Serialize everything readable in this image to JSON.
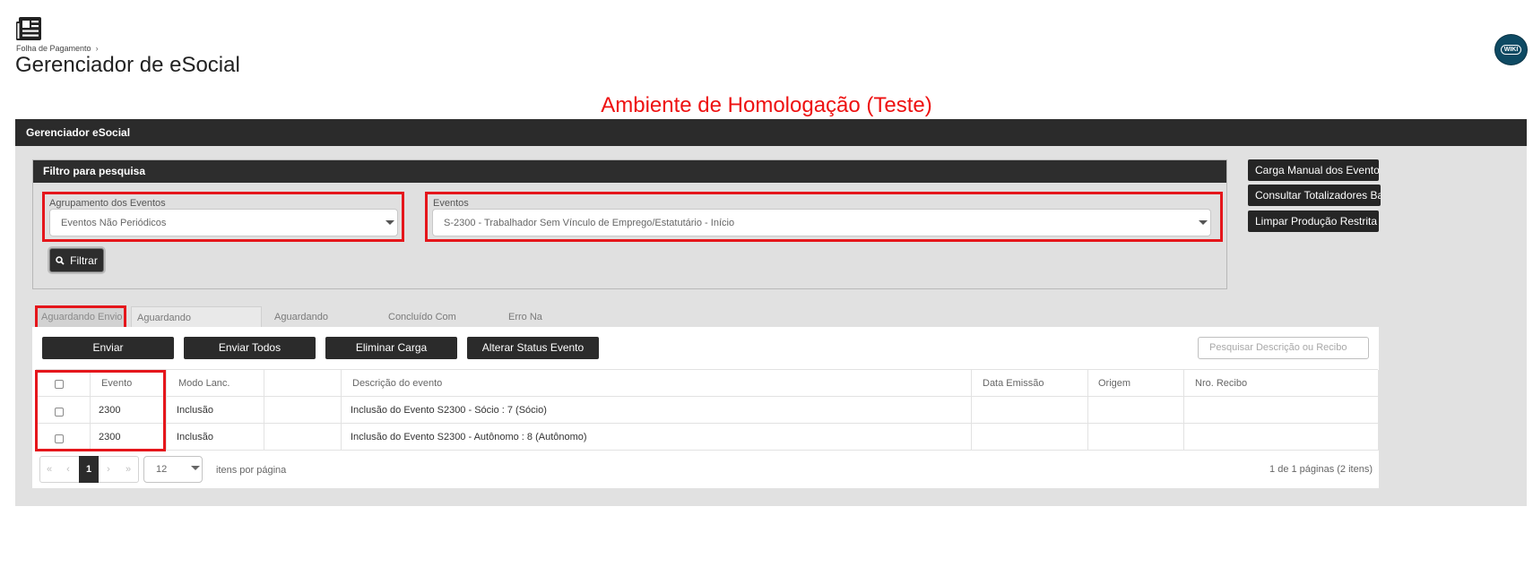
{
  "header": {
    "breadcrumb": "Folha de Pagamento",
    "title": "Gerenciador de eSocial",
    "wiki_label": "WIKI",
    "environment_banner": "Ambiente de Homologação (Teste)"
  },
  "main_panel": {
    "title": "Gerenciador eSocial"
  },
  "filter": {
    "title": "Filtro para pesquisa",
    "group_label": "Agrupamento dos Eventos",
    "group_value": "Eventos Não Periódicos",
    "events_label": "Eventos",
    "events_value": "S-2300 - Trabalhador Sem Vínculo de Emprego/Estatutário - Início",
    "filter_button": "Filtrar"
  },
  "side_actions": [
    "Carga Manual dos Eventos",
    "Consultar Totalizadores Base",
    "Limpar Produção Restrita"
  ],
  "tabs": [
    "Aguardando Envio",
    "Aguardando Processamento",
    "Aguardando Correções",
    "Concluído Com Sucesso",
    "Erro Na Consulta"
  ],
  "toolbar": {
    "send": "Enviar",
    "send_all": "Enviar Todos",
    "delete_load": "Eliminar Carga",
    "change_status": "Alterar Status Evento",
    "search_placeholder": "Pesquisar Descrição ou Recibo"
  },
  "table": {
    "columns": [
      "Evento",
      "Modo Lanc.",
      "",
      "Descrição do evento",
      "Data Emissão",
      "Origem",
      "Nro. Recibo"
    ],
    "rows": [
      {
        "evento": "2300",
        "modo": "Inclusão",
        "extra": "",
        "descricao": "Inclusão do Evento S2300 - Sócio : 7 (Sócio)",
        "data_emissao": "",
        "origem": "",
        "recibo": ""
      },
      {
        "evento": "2300",
        "modo": "Inclusão",
        "extra": "",
        "descricao": "Inclusão do Evento S2300 - Autônomo : 8 (Autônomo)",
        "data_emissao": "",
        "origem": "",
        "recibo": ""
      }
    ]
  },
  "pagination": {
    "first": "«",
    "prev": "‹",
    "current": "1",
    "next": "›",
    "last": "»",
    "per_page": "12",
    "per_page_label": "itens por página",
    "info": "1 de 1 páginas (2 itens)"
  },
  "colors": {
    "highlight": "#e5161b",
    "banner": "#ee1111",
    "dark": "#2b2b2b",
    "wiki": "#0e4a63"
  }
}
